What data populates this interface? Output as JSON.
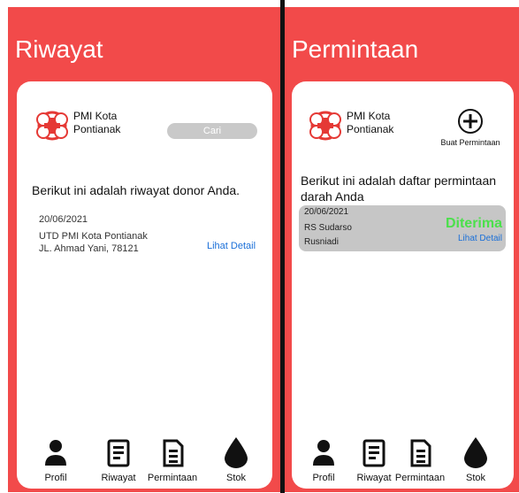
{
  "left": {
    "title": "Riwayat",
    "brand_line1": "PMI Kota",
    "brand_line2": "Pontianak",
    "search_placeholder": "Cari",
    "headline": "Berikut ini adalah riwayat donor Anda.",
    "item": {
      "date": "20/06/2021",
      "name": "UTD PMI Kota Pontianak",
      "address": "JL. Ahmad Yani, 78121",
      "detail": "Lihat Detail"
    },
    "nav": [
      {
        "label": "Profil",
        "icon": "person-icon"
      },
      {
        "label": "Riwayat",
        "icon": "history-icon"
      },
      {
        "label": "Permintaan",
        "icon": "request-icon"
      },
      {
        "label": "Stok",
        "icon": "blood-drop-icon"
      }
    ]
  },
  "right": {
    "title": "Permintaan",
    "brand_line1": "PMI Kota",
    "brand_line2": "Pontianak",
    "add_label": "Buat Permintaan",
    "headline": "Berikut ini adalah daftar permintaan darah Anda",
    "item": {
      "date": "20/06/2021",
      "hospital": "RS Sudarso",
      "person": "Rusniadi",
      "status": "Diterima",
      "detail": "Lihat Detail"
    },
    "nav": [
      {
        "label": "Profil",
        "icon": "person-icon"
      },
      {
        "label": "Riwayat",
        "icon": "history-icon"
      },
      {
        "label": "Permintaan",
        "icon": "request-icon"
      },
      {
        "label": "Stok",
        "icon": "blood-drop-icon"
      }
    ]
  },
  "colors": {
    "background": "#f24a4a",
    "status_green": "#4be04b",
    "link_blue": "#1a6fd8"
  }
}
